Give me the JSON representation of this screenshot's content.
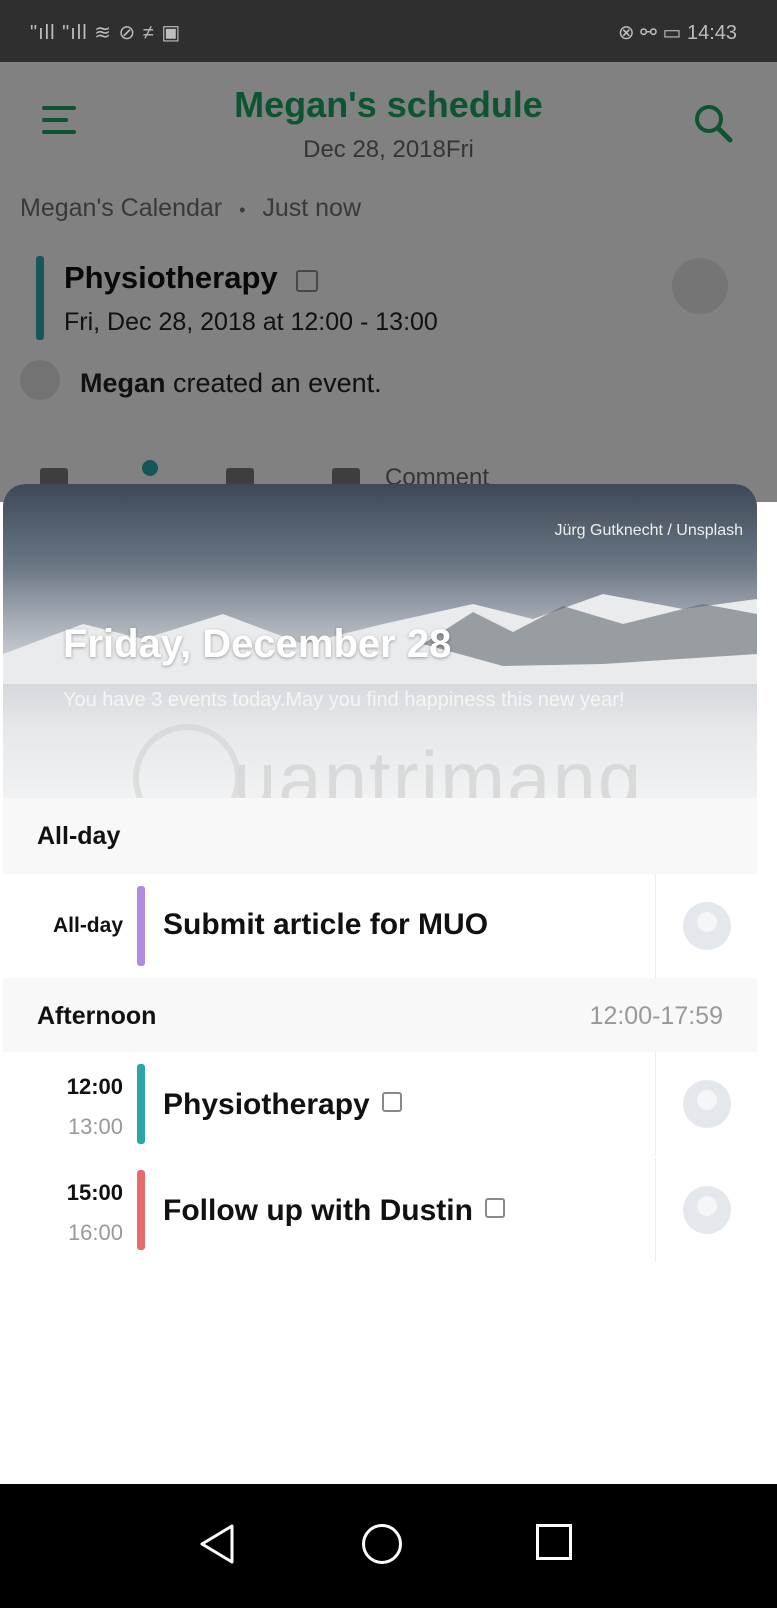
{
  "status_bar": {
    "left": "\"ıll \"ıll ≋ ⊘ ≠ ▣",
    "right": "⊗ ⚯ ▭ 14:43"
  },
  "header": {
    "title": "Megan's schedule",
    "date": "Dec 28, 2018Fri"
  },
  "calendar_bar": {
    "calendar_name": "Megan's Calendar",
    "separator": "•",
    "updated": "Just now"
  },
  "feed_event": {
    "title": "Physiotherapy",
    "time": "Fri, Dec 28, 2018 at 12:00 - 13:00",
    "activity_user": "Megan",
    "activity_text": " created an event."
  },
  "actions": {
    "comment_label": "Comment"
  },
  "hero": {
    "credit": "Jürg Gutknecht / Unsplash",
    "title": "Friday, December 28",
    "subtitle": "You have 3 events today.May you find happiness this new year!"
  },
  "watermark": {
    "text": "uantrimang"
  },
  "sections": {
    "allday": {
      "title": "All-day",
      "event": {
        "time_label": "All-day",
        "title": "Submit article for MUO",
        "color": "#b28be0"
      }
    },
    "afternoon": {
      "title": "Afternoon",
      "range": "12:00-17:59",
      "events": [
        {
          "start": "12:00",
          "end": "13:00",
          "title": "Physiotherapy",
          "color": "#2aa7a8"
        },
        {
          "start": "15:00",
          "end": "16:00",
          "title": "Follow up with Dustin",
          "color": "#e86b6b"
        }
      ]
    }
  },
  "colors": {
    "accent": "#1aa15c",
    "nav_bg": "#000000"
  }
}
